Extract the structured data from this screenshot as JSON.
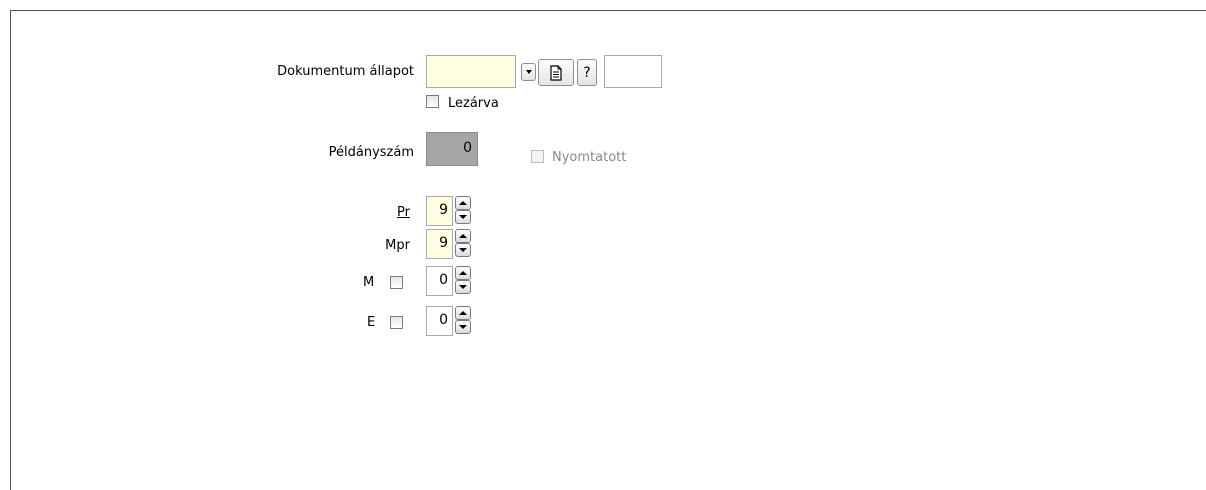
{
  "form": {
    "doc_state_label": "Dokumentum állapot",
    "doc_state_value": "",
    "doc_state_code": "",
    "closed_label": "Lezárva",
    "closed_checked": false,
    "copies_label": "Példányszám",
    "copies_value": "0",
    "printed_label": "Nyomtatott",
    "printed_checked": false,
    "pr_label": "Pr",
    "pr_value": "9",
    "mpr_label": "Mpr",
    "mpr_value": "9",
    "m_label": "M",
    "m_checked": false,
    "m_value": "0",
    "e_label": "E",
    "e_checked": false,
    "e_value": "0",
    "help_glyph": "?"
  },
  "icons": {
    "dropdown": "chevron-down-icon",
    "document": "document-icon",
    "help": "question-icon",
    "spin_up": "arrow-up-icon",
    "spin_down": "arrow-down-icon"
  }
}
